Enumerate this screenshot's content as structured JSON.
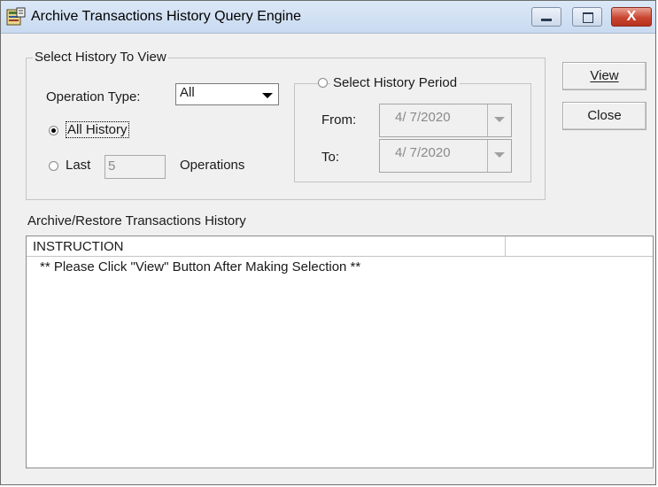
{
  "window": {
    "title": "Archive Transactions History Query Engine",
    "icons": {
      "app": "archive-app-icon",
      "minimize": "minimize-icon",
      "maximize": "maximize-icon",
      "close": "close-icon"
    },
    "close_glyph": "X"
  },
  "select_group": {
    "title": "Select History To View",
    "operation_type_label": "Operation Type:",
    "operation_type_value": "All",
    "all_history_label": "All History",
    "last_label": "Last",
    "last_value": "5",
    "operations_label": "Operations"
  },
  "period_group": {
    "title": "Select History Period",
    "from_label": "From:",
    "from_value": "4/ 7/2020",
    "to_label": "To:",
    "to_value": "4/ 7/2020"
  },
  "buttons": {
    "view": "View",
    "close": "Close"
  },
  "history": {
    "label": "Archive/Restore Transactions History",
    "columns": [
      "INSTRUCTION",
      ""
    ],
    "rows": [
      "** Please Click \"View\" Button After Making Selection **"
    ]
  }
}
